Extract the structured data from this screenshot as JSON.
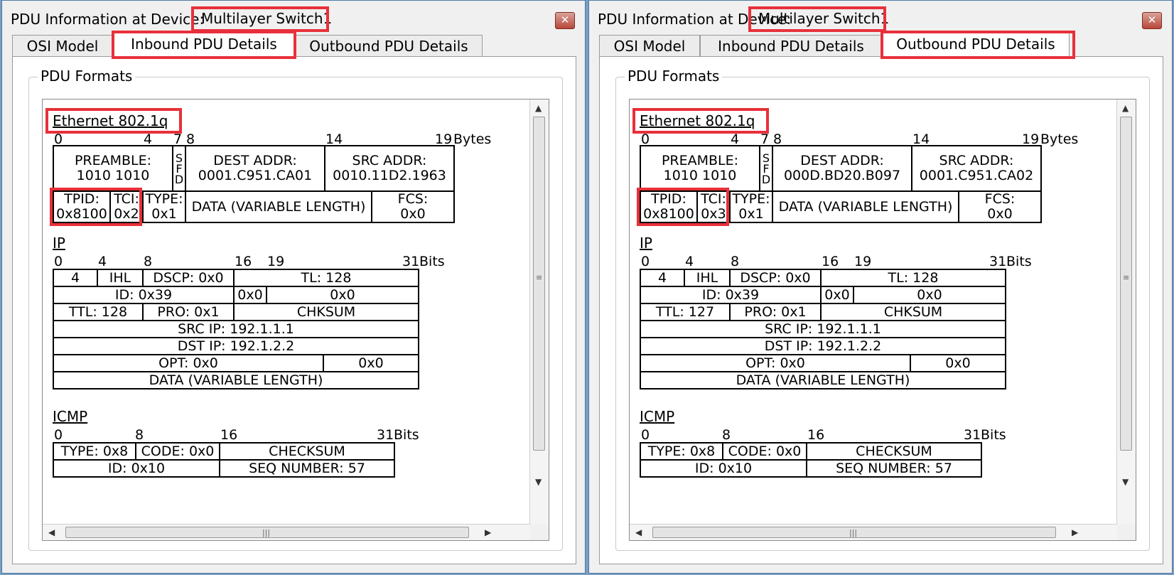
{
  "windows": [
    {
      "title": "PDU Information at Device: ",
      "device": "Multilayer Switch1",
      "close_glyph": "✕",
      "tabs": [
        "OSI Model",
        "Inbound PDU Details",
        "Outbound PDU Details"
      ],
      "active_tab": "Inbound PDU Details",
      "group_label": "PDU Formats",
      "ethernet": {
        "title": "Ethernet 802.1q",
        "ruler": [
          "0",
          "4",
          "7",
          "8",
          "14",
          "19",
          "Bytes"
        ],
        "preamble": [
          "PREAMBLE:",
          "1010 1010"
        ],
        "sfd": "SFD",
        "dest": [
          "DEST ADDR:",
          "0001.C951.CA01"
        ],
        "src": [
          "SRC ADDR:",
          "0010.11D2.1963"
        ],
        "tpid": [
          "TPID:",
          "0x8100"
        ],
        "tci": [
          "TCI:",
          "0x2"
        ],
        "type": [
          "TYPE:",
          "0x1"
        ],
        "data": "DATA (VARIABLE LENGTH)",
        "fcs": [
          "FCS:",
          "0x0"
        ]
      },
      "ip": {
        "title": "IP",
        "ruler": [
          "0",
          "4",
          "8",
          "16",
          "19",
          "31",
          "Bits"
        ],
        "version": "4",
        "ihl": "IHL",
        "dscp": "DSCP: 0x0",
        "tl": "TL: 128",
        "id": "ID: 0x39",
        "flags": "0x0",
        "frag": "0x0",
        "ttl": "TTL: 128",
        "pro": "PRO: 0x1",
        "chksum": "CHKSUM",
        "src_ip": "SRC IP: 192.1.1.1",
        "dst_ip": "DST IP: 192.1.2.2",
        "opt": "OPT: 0x0",
        "pad": "0x0",
        "data": "DATA (VARIABLE LENGTH)"
      },
      "icmp": {
        "title": "ICMP",
        "ruler": [
          "0",
          "8",
          "16",
          "31",
          "Bits"
        ],
        "type": "TYPE: 0x8",
        "code": "CODE: 0x0",
        "checksum": "CHECKSUM",
        "id": "ID: 0x10",
        "seq": "SEQ NUMBER: 57"
      }
    },
    {
      "title": "PDU Information at Device: ",
      "device": "Multilayer Switch1",
      "close_glyph": "✕",
      "tabs": [
        "OSI Model",
        "Inbound PDU Details",
        "Outbound PDU Details"
      ],
      "active_tab": "Outbound PDU Details",
      "group_label": "PDU Formats",
      "ethernet": {
        "title": "Ethernet 802.1q",
        "ruler": [
          "0",
          "4",
          "7",
          "8",
          "14",
          "19",
          "Bytes"
        ],
        "preamble": [
          "PREAMBLE:",
          "1010 1010"
        ],
        "sfd": "SFD",
        "dest": [
          "DEST ADDR:",
          "000D.BD20.B097"
        ],
        "src": [
          "SRC ADDR:",
          "0001.C951.CA02"
        ],
        "tpid": [
          "TPID:",
          "0x8100"
        ],
        "tci": [
          "TCI:",
          "0x3"
        ],
        "type": [
          "TYPE:",
          "0x1"
        ],
        "data": "DATA (VARIABLE LENGTH)",
        "fcs": [
          "FCS:",
          "0x0"
        ]
      },
      "ip": {
        "title": "IP",
        "ruler": [
          "0",
          "4",
          "8",
          "16",
          "19",
          "31",
          "Bits"
        ],
        "version": "4",
        "ihl": "IHL",
        "dscp": "DSCP: 0x0",
        "tl": "TL: 128",
        "id": "ID: 0x39",
        "flags": "0x0",
        "frag": "0x0",
        "ttl": "TTL: 127",
        "pro": "PRO: 0x1",
        "chksum": "CHKSUM",
        "src_ip": "SRC IP: 192.1.1.1",
        "dst_ip": "DST IP: 192.1.2.2",
        "opt": "OPT: 0x0",
        "pad": "0x0",
        "data": "DATA (VARIABLE LENGTH)"
      },
      "icmp": {
        "title": "ICMP",
        "ruler": [
          "0",
          "8",
          "16",
          "31",
          "Bits"
        ],
        "type": "TYPE: 0x8",
        "code": "CODE: 0x0",
        "checksum": "CHECKSUM",
        "id": "ID: 0x10",
        "seq": "SEQ NUMBER: 57"
      }
    }
  ],
  "colors": {
    "highlight": "#e8303a",
    "window_border": "#4f7aa5"
  }
}
